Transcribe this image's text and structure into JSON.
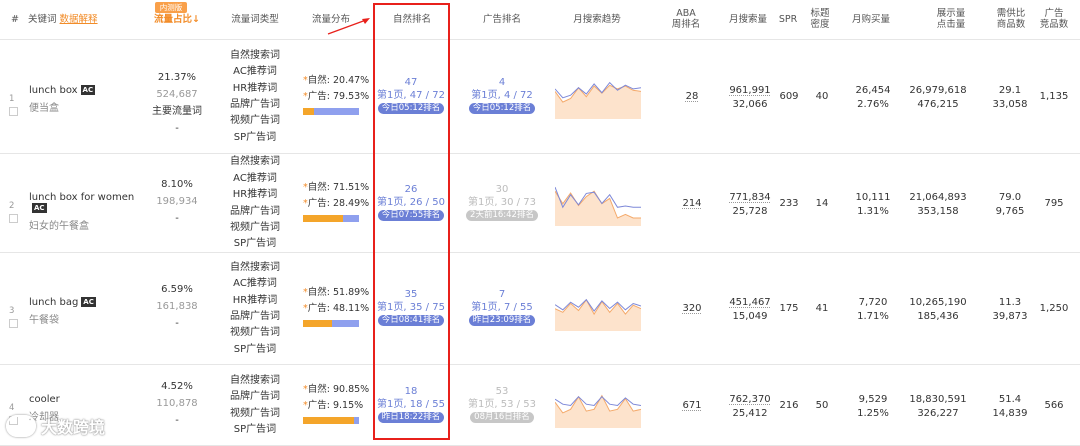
{
  "header": {
    "hash": "#",
    "keyword": "关键词",
    "data_explain": "数据解释",
    "test_badge": "内测版",
    "traffic_share": "流量占比↓",
    "word_type": "流量词类型",
    "traffic_dist": "流量分布",
    "natural_rank": "自然排名",
    "ad_rank": "广告排名",
    "monthly_trend": "月搜索趋势",
    "aba_rank": [
      "ABA",
      "周排名"
    ],
    "monthly_search": "月搜索量",
    "spr": "SPR",
    "title_density": [
      "标题",
      "密度"
    ],
    "monthly_buy": "月购买量",
    "impress_click": [
      "展示量",
      "点击量"
    ],
    "supply_demand": [
      "需供比",
      "商品数"
    ],
    "ad_products": [
      "广告",
      "竞品数"
    ]
  },
  "colors": {
    "accent_blue": "#6b7fd6",
    "orange": "#f28c28",
    "highlight_red": "#e8201b"
  },
  "rows": [
    {
      "index": "1",
      "keyword": "lunch box",
      "ac": "AC",
      "translation": "便当盒",
      "share": "21.37%",
      "share_count": "524,687",
      "share_label": "主要流量词",
      "share_dash": "-",
      "types": [
        "自然搜索词",
        "AC推荐词",
        "HR推荐词",
        "品牌广告词",
        "视频广告词",
        "SP广告词"
      ],
      "natural_label": "自然:",
      "natural_pct": "20.47%",
      "ad_label": "广告:",
      "ad_pct": "79.53%",
      "natural_share": 0.2047,
      "nat_rank": "47",
      "nat_page": "第1页, 47 / 72",
      "nat_time": "今日05:12排名",
      "ad_rank": "4",
      "ad_page": "第1页, 4 / 72",
      "ad_time": "今日05:12排名",
      "ad_dim": false,
      "trend_blue": [
        0.55,
        0.2,
        0.3,
        0.6,
        0.35,
        0.75,
        0.4,
        0.8,
        0.5,
        0.7,
        0.55,
        0.6
      ],
      "trend_orange": [
        0.75,
        0.45,
        0.55,
        0.85,
        0.6,
        0.9,
        0.7,
        0.92,
        0.82,
        0.9,
        0.78,
        0.75
      ],
      "aba": "28",
      "search": "961,991",
      "search2": "32,066",
      "spr": "609",
      "density": "40",
      "buy": "26,454",
      "buy_rate": "2.76%",
      "impress": "26,979,618",
      "clicks": "476,215",
      "ratio": "29.1",
      "products": "33,058",
      "ad_products": "1,135"
    },
    {
      "index": "2",
      "keyword": "lunch box for women",
      "ac": "AC",
      "translation": "妇女的午餐盒",
      "share": "8.10%",
      "share_count": "198,934",
      "share_label": "",
      "share_dash": "-",
      "types": [
        "自然搜索词",
        "AC推荐词",
        "HR推荐词",
        "品牌广告词",
        "视频广告词",
        "SP广告词"
      ],
      "natural_label": "自然:",
      "natural_pct": "71.51%",
      "ad_label": "广告:",
      "ad_pct": "28.49%",
      "natural_share": 0.7151,
      "nat_rank": "26",
      "nat_page": "第1页, 26 / 50",
      "nat_time": "今日07:55排名",
      "ad_rank": "30",
      "ad_page": "第1页, 30 / 73",
      "ad_time": "2天前16:42排名",
      "ad_dim": true,
      "trend_blue": [
        0.9,
        0.1,
        0.6,
        0.2,
        0.65,
        0.7,
        0.25,
        0.6,
        0.1,
        0.15,
        0.1,
        0.1
      ],
      "trend_orange": [
        0.95,
        0.6,
        0.9,
        0.55,
        0.8,
        0.95,
        0.6,
        0.75,
        0.2,
        0.3,
        0.2,
        0.2
      ],
      "aba": "214",
      "search": "771,834",
      "search2": "25,728",
      "spr": "233",
      "density": "14",
      "buy": "10,111",
      "buy_rate": "1.31%",
      "impress": "21,064,893",
      "clicks": "353,158",
      "ratio": "79.0",
      "products": "9,765",
      "ad_products": "795"
    },
    {
      "index": "3",
      "keyword": "lunch bag",
      "ac": "AC",
      "translation": "午餐袋",
      "share": "6.59%",
      "share_count": "161,838",
      "share_label": "",
      "share_dash": "-",
      "types": [
        "自然搜索词",
        "AC推荐词",
        "HR推荐词",
        "品牌广告词",
        "视频广告词",
        "SP广告词"
      ],
      "natural_label": "自然:",
      "natural_pct": "51.89%",
      "ad_label": "广告:",
      "ad_pct": "48.11%",
      "natural_share": 0.5189,
      "nat_rank": "35",
      "nat_page": "第1页, 35 / 75",
      "nat_time": "今日08:41排名",
      "ad_rank": "7",
      "ad_page": "第1页, 7 / 55",
      "ad_time": "昨日23:09排名",
      "ad_dim": false,
      "trend_blue": [
        0.4,
        0.2,
        0.5,
        0.3,
        0.6,
        0.15,
        0.55,
        0.25,
        0.5,
        0.2,
        0.45,
        0.35
      ],
      "trend_orange": [
        0.6,
        0.5,
        0.75,
        0.55,
        0.85,
        0.45,
        0.8,
        0.5,
        0.75,
        0.45,
        0.7,
        0.6
      ],
      "aba": "320",
      "search": "451,467",
      "search2": "15,049",
      "spr": "175",
      "density": "41",
      "buy": "7,720",
      "buy_rate": "1.71%",
      "impress": "10,265,190",
      "clicks": "185,436",
      "ratio": "11.3",
      "products": "39,873",
      "ad_products": "1,250"
    },
    {
      "index": "4",
      "keyword": "cooler",
      "ac": "",
      "translation": "冷却器",
      "share": "4.52%",
      "share_count": "110,878",
      "share_label": "",
      "share_dash": "-",
      "types": [
        "自然搜索词",
        "品牌广告词",
        "视频广告词",
        "SP广告词"
      ],
      "natural_label": "自然:",
      "natural_pct": "90.85%",
      "ad_label": "广告:",
      "ad_pct": "9.15%",
      "natural_share": 0.9085,
      "nat_rank": "18",
      "nat_page": "第1页, 18 / 55",
      "nat_time": "昨日18:22排名",
      "ad_rank": "53",
      "ad_page": "第1页, 53 / 53",
      "ad_time": "08月16日排名",
      "ad_dim": true,
      "trend_blue": [
        0.5,
        0.3,
        0.25,
        0.6,
        0.3,
        0.25,
        0.6,
        0.3,
        0.25,
        0.55,
        0.3,
        0.25
      ],
      "trend_orange": [
        0.7,
        0.4,
        0.5,
        0.85,
        0.45,
        0.5,
        0.88,
        0.45,
        0.5,
        0.8,
        0.45,
        0.5
      ],
      "aba": "671",
      "search": "762,370",
      "search2": "25,412",
      "spr": "216",
      "density": "50",
      "buy": "9,529",
      "buy_rate": "1.25%",
      "impress": "18,830,591",
      "clicks": "326,227",
      "ratio": "51.4",
      "products": "14,839",
      "ad_products": "566"
    }
  ],
  "watermark": "大数跨境"
}
